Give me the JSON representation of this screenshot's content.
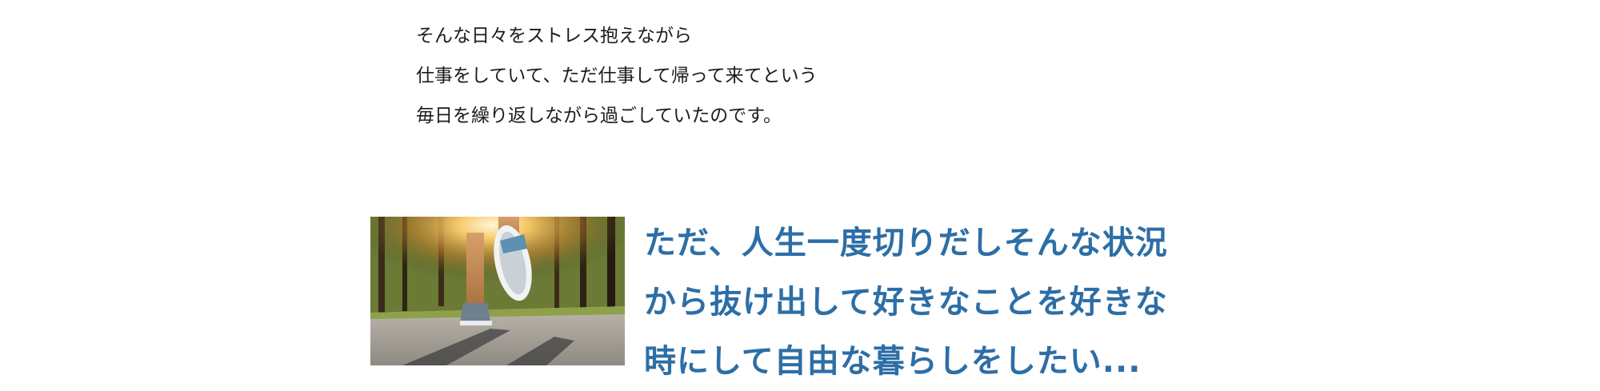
{
  "intro": {
    "lines": [
      "そんな日々をストレス抱えながら",
      "仕事をしていて、ただ仕事して帰って来てという",
      "毎日を繰り返しながら過ごしていたのです。"
    ]
  },
  "feature": {
    "image_subject": "running-shoes-on-road-photo",
    "headline_lines": [
      "ただ、人生一度切りだしそんな状況",
      "から抜け出して好きなことを好きな",
      "時にして自由な暮らしをしたい..."
    ]
  },
  "colors": {
    "body_text": "#1c1c1c",
    "headline": "#2d6ea6",
    "background": "#ffffff"
  }
}
